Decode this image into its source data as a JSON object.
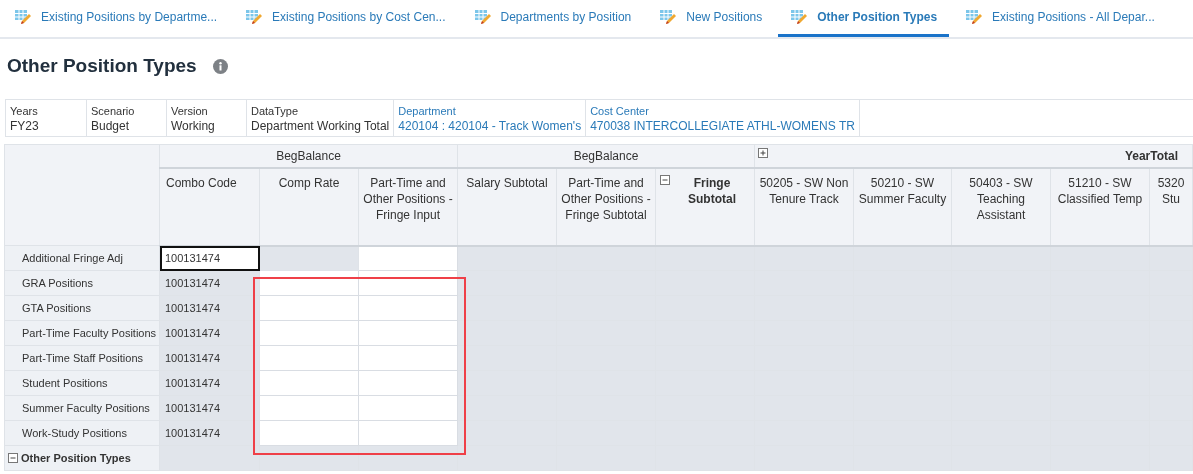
{
  "tabs": [
    {
      "label": "Existing Positions by Departme...",
      "selected": false
    },
    {
      "label": "Existing Positions by Cost Cen...",
      "selected": false
    },
    {
      "label": "Departments by Position",
      "selected": false
    },
    {
      "label": "New Positions",
      "selected": false
    },
    {
      "label": "Other Position Types",
      "selected": true
    },
    {
      "label": "Existing Positions - All Depar...",
      "selected": false
    }
  ],
  "page_title": "Other Position Types",
  "pov": [
    {
      "label": "Years",
      "value": "FY23",
      "kind": "plain"
    },
    {
      "label": "Scenario",
      "value": "Budget",
      "kind": "plain"
    },
    {
      "label": "Version",
      "value": "Working",
      "kind": "plain"
    },
    {
      "label": "DataType",
      "value": "Department Working Total",
      "kind": "plain"
    },
    {
      "label": "Department",
      "value": "420104 : 420104 - Track Women's",
      "kind": "link"
    },
    {
      "label": "Cost Center",
      "value": "470038 INTERCOLLEGIATE ATHL-WOMENS TR",
      "kind": "link"
    }
  ],
  "grid": {
    "column_groups": [
      {
        "label": "BegBalance",
        "columns": [
          {
            "label": "Combo Code"
          },
          {
            "label": "Comp Rate"
          },
          {
            "label": "Part-Time and Other Positions - Fringe Input"
          }
        ]
      },
      {
        "label": "BegBalance",
        "columns": [
          {
            "label": "Salary Subtotal"
          },
          {
            "label": "Part-Time and Other Positions - Fringe Subtotal"
          },
          {
            "label": "Fringe Subtotal",
            "expanded": true
          }
        ]
      },
      {
        "label": "YearTotal",
        "expanded": false,
        "columns": [
          {
            "label": "50205 - SW Non Tenure Track"
          },
          {
            "label": "50210 - SW Summer Faculty"
          },
          {
            "label": "50403 - SW Teaching Assistant"
          },
          {
            "label": "51210 - SW Classified Temp"
          },
          {
            "label": "5320 Stu"
          }
        ]
      }
    ],
    "rows": [
      {
        "label": "Other Position Types",
        "expanded": true,
        "children": [
          {
            "label": "Additional Fringe Adj",
            "code": "100131474",
            "code_selected": true,
            "comp_rate_editable": false,
            "fringe_input_editable": true
          },
          {
            "label": "GRA Positions",
            "code": "100131474",
            "code_selected": false,
            "comp_rate_editable": true,
            "fringe_input_editable": true
          },
          {
            "label": "GTA Positions",
            "code": "100131474",
            "code_selected": false,
            "comp_rate_editable": true,
            "fringe_input_editable": true
          },
          {
            "label": "Part-Time Faculty Positions",
            "code": "100131474",
            "code_selected": false,
            "comp_rate_editable": true,
            "fringe_input_editable": true
          },
          {
            "label": "Part-Time Staff Positions",
            "code": "100131474",
            "code_selected": false,
            "comp_rate_editable": true,
            "fringe_input_editable": true
          },
          {
            "label": "Student Positions",
            "code": "100131474",
            "code_selected": false,
            "comp_rate_editable": true,
            "fringe_input_editable": true
          },
          {
            "label": "Summer Faculty Positions",
            "code": "100131474",
            "code_selected": false,
            "comp_rate_editable": true,
            "fringe_input_editable": true
          },
          {
            "label": "Work-Study Positions",
            "code": "100131474",
            "code_selected": false,
            "comp_rate_editable": true,
            "fringe_input_editable": true
          }
        ]
      }
    ]
  }
}
